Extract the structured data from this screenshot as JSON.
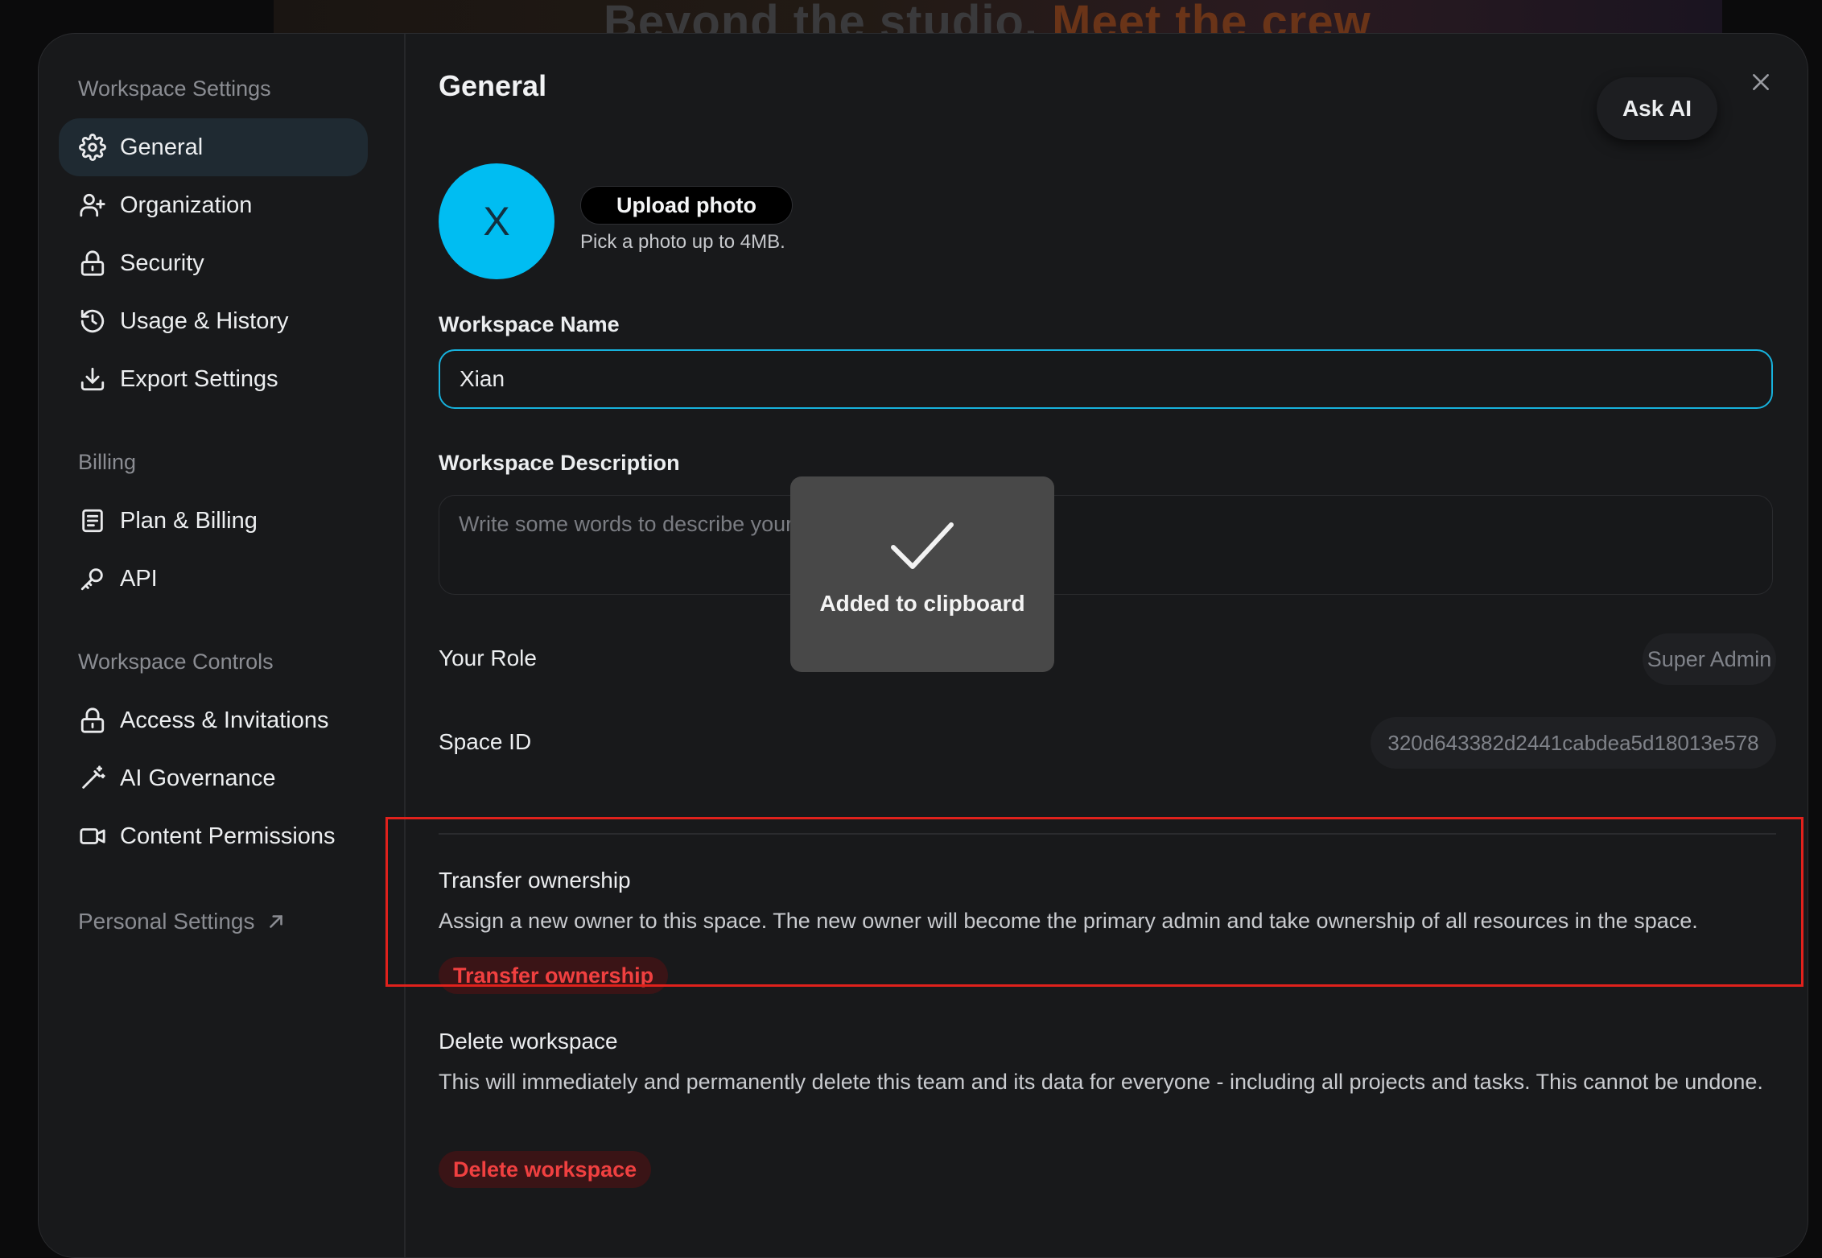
{
  "backdrop": {
    "headline_part1": "Beyond the studio.",
    "headline_part2": "Meet the crew"
  },
  "sidebar": {
    "sections": [
      {
        "title": "Workspace Settings",
        "items": [
          {
            "label": "General",
            "icon": "gear-icon",
            "active": true
          },
          {
            "label": "Organization",
            "icon": "user-plus-icon"
          },
          {
            "label": "Security",
            "icon": "lock-icon"
          },
          {
            "label": "Usage & History",
            "icon": "history-icon"
          },
          {
            "label": "Export Settings",
            "icon": "download-icon"
          }
        ]
      },
      {
        "title": "Billing",
        "items": [
          {
            "label": "Plan & Billing",
            "icon": "document-icon"
          },
          {
            "label": "API",
            "icon": "key-icon"
          }
        ]
      },
      {
        "title": "Workspace Controls",
        "items": [
          {
            "label": "Access & Invitations",
            "icon": "lock-icon"
          },
          {
            "label": "AI Governance",
            "icon": "magic-wand-icon"
          },
          {
            "label": "Content Permissions",
            "icon": "video-icon"
          }
        ]
      }
    ],
    "personal_settings": "Personal Settings"
  },
  "main": {
    "title": "General",
    "ask_ai": "Ask AI",
    "avatar_letter": "X",
    "upload_label": "Upload photo",
    "upload_hint": "Pick a photo up to 4MB.",
    "name_label": "Workspace Name",
    "name_value": "Xian",
    "description_label": "Workspace Description",
    "description_placeholder": "Write some words to describe your workspace",
    "role_label": "Your Role",
    "role_value": "Super Admin",
    "space_id_label": "Space ID",
    "space_id_value": "320d643382d2441cabdea5d18013e578",
    "transfer": {
      "title": "Transfer ownership",
      "description": "Assign a new owner to this space. The new owner will become the primary admin and take ownership of all resources in the space.",
      "button": "Transfer ownership"
    },
    "delete": {
      "title": "Delete workspace",
      "description": "This will immediately and permanently delete this team and its data for everyone - including all projects and tasks. This cannot be undone.",
      "button": "Delete workspace"
    }
  },
  "toast": {
    "message": "Added to clipboard"
  },
  "colors": {
    "accent": "#00bdf2",
    "danger": "#f04040",
    "highlight_box": "#e0211c"
  }
}
